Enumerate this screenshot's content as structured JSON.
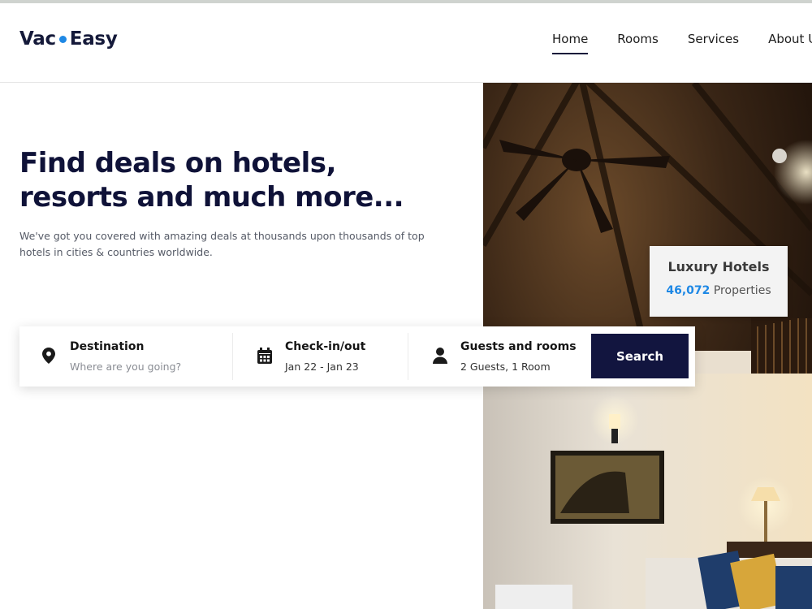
{
  "brand": {
    "name_left": "Vac",
    "name_right": "Easy",
    "accent": "#1e88e5"
  },
  "nav": {
    "items": [
      {
        "label": "Home",
        "active": true
      },
      {
        "label": "Rooms"
      },
      {
        "label": "Services"
      },
      {
        "label": "About Us"
      }
    ]
  },
  "hero": {
    "title_line1": "Find deals on hotels,",
    "title_line2": "resorts and much more...",
    "subtitle": "We've got you covered with amazing deals at thousands upon thousands of top hotels in cities & countries worldwide."
  },
  "luxury": {
    "title": "Luxury Hotels",
    "count": "46,072",
    "suffix": " Properties"
  },
  "search": {
    "destination": {
      "label": "Destination",
      "placeholder": "Where are you going?",
      "icon": "map-pin-icon"
    },
    "dates": {
      "label": "Check-in/out",
      "value": "Jan 22 - Jan 23",
      "icon": "calendar-icon"
    },
    "guests": {
      "label": "Guests and rooms",
      "value": "2 Guests, 1 Room",
      "icon": "person-icon"
    },
    "button": "Search"
  },
  "colors": {
    "navy": "#12153f",
    "blue": "#1e88e5"
  }
}
